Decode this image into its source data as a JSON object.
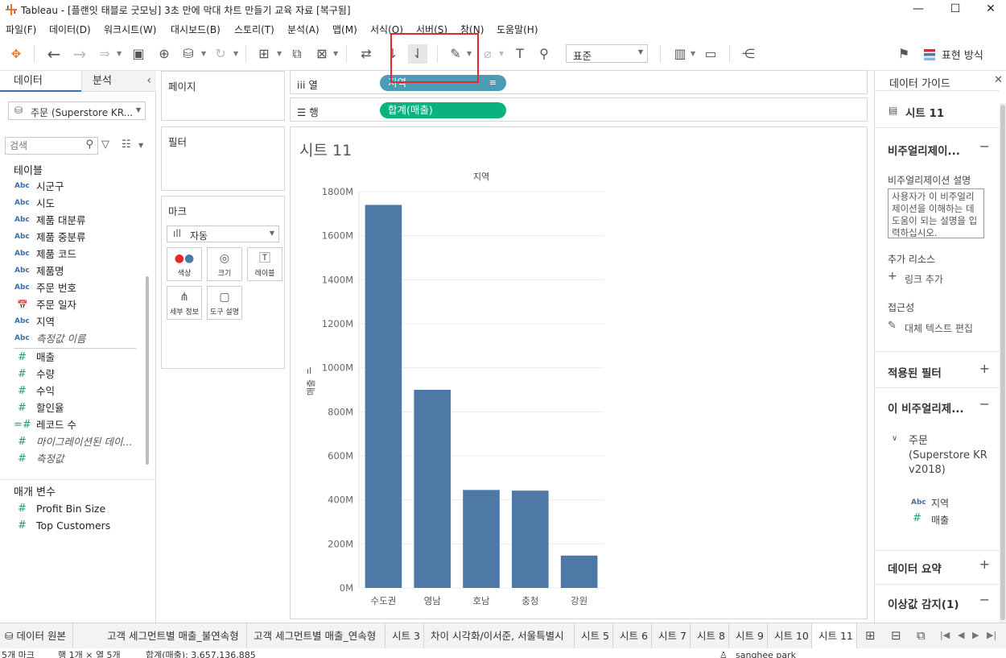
{
  "window": {
    "title": "Tableau - [플랜잇 태블로 굿모닝] 3초 만에 막대 차트 만들기 교육 자료 [복구됨]",
    "minimize": "—",
    "maximize": "☐",
    "close": "✕"
  },
  "menu": [
    "파일(F)",
    "데이터(D)",
    "워크시트(W)",
    "대시보드(B)",
    "스토리(T)",
    "분석(A)",
    "맵(M)",
    "서식(O)",
    "서버(S)",
    "창(N)",
    "도움말(H)"
  ],
  "toolbar": {
    "fit_select": "표준",
    "show_me": "표현 방식"
  },
  "left_pane": {
    "tab_data": "데이터",
    "tab_analysis": "분석",
    "datasource": "주문 (Superstore KR...",
    "search_placeholder": "검색",
    "tables_header": "테이블",
    "dimensions": [
      {
        "type": "Abc",
        "name": "시군구"
      },
      {
        "type": "Abc",
        "name": "시도"
      },
      {
        "type": "Abc",
        "name": "제품 대분류"
      },
      {
        "type": "Abc",
        "name": "제품 중분류"
      },
      {
        "type": "Abc",
        "name": "제품 코드"
      },
      {
        "type": "Abc",
        "name": "제품명"
      },
      {
        "type": "Abc",
        "name": "주문 번호"
      },
      {
        "type": "date",
        "name": "주문 일자"
      },
      {
        "type": "Abc",
        "name": "지역"
      },
      {
        "type": "Abc",
        "name": "측정값 이름",
        "italic": true
      }
    ],
    "measures": [
      {
        "type": "#",
        "name": "매출"
      },
      {
        "type": "#",
        "name": "수량"
      },
      {
        "type": "#",
        "name": "수익"
      },
      {
        "type": "#",
        "name": "할인율"
      },
      {
        "type": "=#",
        "name": "레코드 수"
      },
      {
        "type": "#",
        "name": "마이그레이션된 데이...",
        "italic": true
      },
      {
        "type": "#",
        "name": "측정값",
        "italic": true
      }
    ],
    "params_header": "매개 변수",
    "parameters": [
      {
        "type": "#",
        "name": "Profit Bin Size"
      },
      {
        "type": "#",
        "name": "Top Customers"
      }
    ]
  },
  "cards": {
    "pages": "페이지",
    "filters": "필터",
    "marks": "마크",
    "mark_type": "자동",
    "mark_buttons": [
      "색상",
      "크기",
      "레이블",
      "세부 정보",
      "도구 설명"
    ]
  },
  "shelves": {
    "columns_label": "열",
    "rows_label": "행",
    "columns_pill": "지역",
    "rows_pill": "합계(매출)",
    "columns_pill_color": "#4a9bb5",
    "rows_pill_color": "#0ab27d"
  },
  "sheet": {
    "title": "시트 11",
    "header": "지역",
    "yaxis_title": "매출"
  },
  "chart_data": {
    "type": "bar",
    "title": "",
    "xlabel": "지역",
    "ylabel": "매출",
    "categories": [
      "수도권",
      "영남",
      "호남",
      "충청",
      "강원"
    ],
    "values": [
      1740,
      900,
      445,
      442,
      147
    ],
    "unit_suffix": "M",
    "ylim": [
      0,
      1800
    ],
    "yticks": [
      0,
      200,
      400,
      600,
      800,
      1000,
      1200,
      1400,
      1600,
      1800
    ],
    "ytick_labels": [
      "0M",
      "200M",
      "400M",
      "600M",
      "800M",
      "1000M",
      "1200M",
      "1400M",
      "1600M",
      "1800M"
    ],
    "bar_color": "#4e79a7",
    "grid": true
  },
  "right_pane": {
    "title": "데이터 가이드",
    "sheet_name": "시트 11",
    "viz_section": "비주얼리제이...",
    "viz_desc_label": "비주얼리제이션 설명",
    "viz_desc_placeholder": "사용자가 이 비주얼리제이션을 이해하는 데 도움이 되는 설명을 입력하십시오.",
    "add_resources": "추가 리소스",
    "add_link": "링크 추가",
    "accessibility": "접근성",
    "alt_text": "대체 텍스트 편집",
    "applied_filters": "적용된 필터",
    "this_viz": "이 비주얼리제...",
    "source_name": "주문 (Superstore KR v2018)",
    "fields": [
      {
        "type": "Abc",
        "name": "지역"
      },
      {
        "type": "#",
        "name": "매출"
      }
    ],
    "data_summary": "데이터 요약",
    "outliers": "이상값 감지(1)"
  },
  "tabs": {
    "datasource": "데이터 원본",
    "sheets": [
      "고객 세그먼트별 매출_불연속형",
      "고객 세그먼트별 매출_연속형",
      "시트 3",
      "차이 시각화/이서준, 서울특별시",
      "시트 5",
      "시트 6",
      "시트 7",
      "시트 8",
      "시트 9",
      "시트 10",
      "시트 11"
    ],
    "active": "시트 11"
  },
  "status": {
    "marks": "5개 마크",
    "rows_cols": "행 1개 × 열 5개",
    "sum": "합계(매출): 3,657,136,885",
    "user": "sanghee park"
  }
}
